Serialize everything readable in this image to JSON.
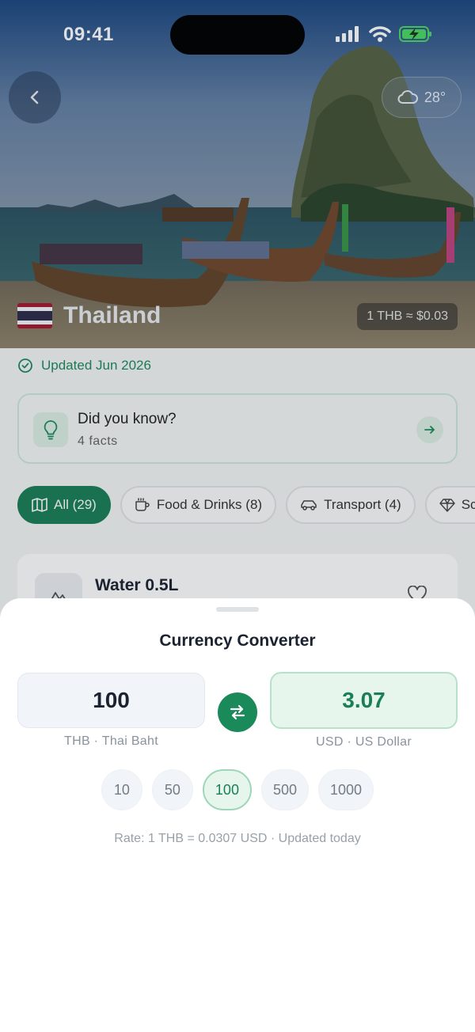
{
  "status": {
    "time": "09:41"
  },
  "hero": {
    "country": "Thailand",
    "weather": "28°",
    "rate_pill": "1 THB ≈ $0.03",
    "flag_colors": [
      "#a51931",
      "#f4f5f8",
      "#2d2a4a",
      "#f4f5f8",
      "#a51931"
    ]
  },
  "page": {
    "updated": "Updated Jun 2026",
    "did_you_know": {
      "title": "Did you know?",
      "subtitle": "4 facts"
    },
    "chips": [
      {
        "label": "All (29)",
        "icon": "map-icon",
        "active": true
      },
      {
        "label": "Food & Drinks (8)",
        "icon": "cup-icon",
        "active": false
      },
      {
        "label": "Transport (4)",
        "icon": "car-icon",
        "active": false
      },
      {
        "label": "Sc",
        "icon": "diamond-icon",
        "active": false
      }
    ],
    "card": {
      "title": "Water 0.5L"
    }
  },
  "converter": {
    "title": "Currency Converter",
    "from_value": "100",
    "from_label": "THB · Thai Baht",
    "to_value": "3.07",
    "to_label": "USD · US Dollar",
    "presets": [
      "10",
      "50",
      "100",
      "500",
      "1000"
    ],
    "selected_preset": "100",
    "rate_text": "Rate: 1 THB = 0.0307 USD · Updated today"
  },
  "colors": {
    "accent": "#1a7f55",
    "accent_light": "#e6f6ed"
  }
}
